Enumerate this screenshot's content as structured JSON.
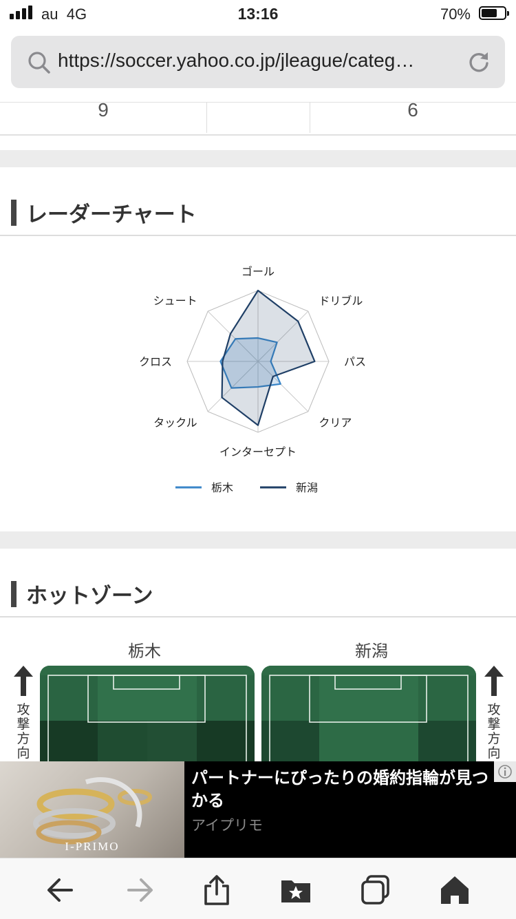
{
  "status_bar": {
    "carrier": "au",
    "network": "4G",
    "time": "13:16",
    "battery_pct": "70%",
    "battery_level": 0.7,
    "signal_bars": 4
  },
  "browser": {
    "url": "https://soccer.yahoo.co.jp/jleague/categ…"
  },
  "score_row": {
    "left": "9",
    "right": "6"
  },
  "radar_section": {
    "title": "レーダーチャート"
  },
  "chart_data": {
    "type": "radar",
    "axes": [
      "ゴール",
      "ドリブル",
      "パス",
      "クリア",
      "インターセプト",
      "タックル",
      "クロス",
      "シュート"
    ],
    "rmax": 1.0,
    "grid": true,
    "legend_position": "bottom",
    "series": [
      {
        "name": "栃木",
        "color": "#3a86c8",
        "values": [
          0.33,
          0.38,
          0.18,
          0.45,
          0.36,
          0.53,
          0.53,
          0.45
        ]
      },
      {
        "name": "新潟",
        "color": "#1f3f66",
        "values": [
          1.0,
          0.8,
          0.8,
          0.3,
          0.9,
          0.72,
          0.5,
          0.55
        ]
      }
    ]
  },
  "hotzone_section": {
    "title": "ホットゾーン",
    "teams": [
      "栃木",
      "新潟"
    ],
    "attack_direction": "攻撃方向"
  },
  "ad": {
    "title": "パートナーにぴったりの婚約指輪が見つかる",
    "sponsor": "アイプリモ",
    "brand": "I-PRIMO"
  },
  "toolbar": {
    "items": [
      "back-icon",
      "forward-icon",
      "share-icon",
      "bookmarks-icon",
      "tabs-icon",
      "home-icon"
    ]
  },
  "colors": {
    "radar_tochigi": "#3a86c8",
    "radar_niigata": "#1f3f66",
    "pitch_green": "#2e6b46"
  }
}
